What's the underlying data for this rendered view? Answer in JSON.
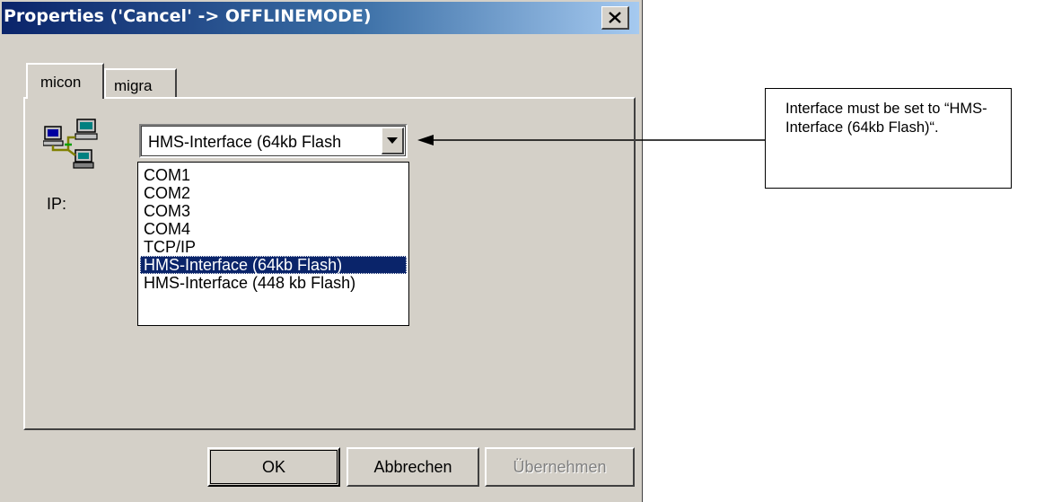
{
  "window": {
    "title": "Properties ('Cancel' -> OFFLINEMODE)"
  },
  "tabs": [
    {
      "label": "micon",
      "active": true
    },
    {
      "label": "migra",
      "active": false
    }
  ],
  "fields": {
    "ip_label": "IP:"
  },
  "interface_select": {
    "value": "HMS-Interface (64kb Flash",
    "options": [
      "COM1",
      "COM2",
      "COM3",
      "COM4",
      "TCP/IP",
      "HMS-Interface (64kb Flash)",
      "HMS-Interface (448 kb Flash)"
    ],
    "highlighted_index": 5
  },
  "buttons": {
    "ok": "OK",
    "cancel": "Abbrechen",
    "apply": "Übernehmen"
  },
  "annotation": {
    "text": "Interface must be set to “HMS-Interface (64kb Flash)“."
  },
  "colors": {
    "title_bar_start": "#0a246a",
    "title_bar_end": "#a6caf0",
    "dialog_face": "#d4d0c8",
    "selection": "#0a246a"
  },
  "icons": [
    "close-icon",
    "network-computers-icon",
    "dropdown-arrow-icon"
  ]
}
